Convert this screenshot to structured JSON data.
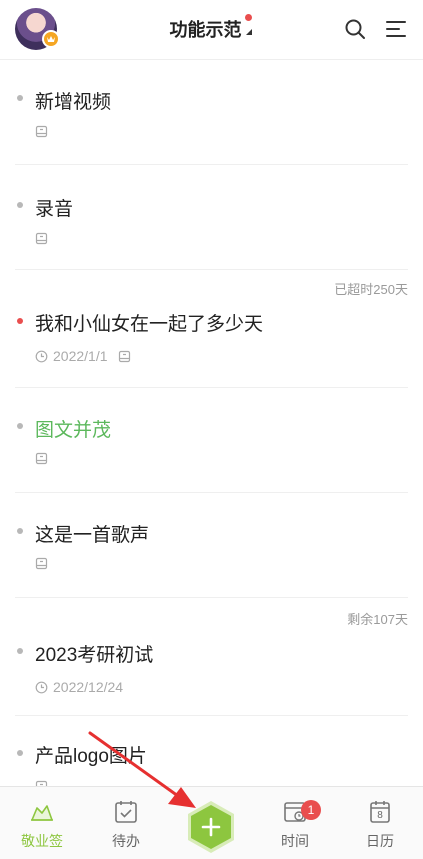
{
  "header": {
    "title": "功能示范"
  },
  "items": [
    {
      "name": "新增视频",
      "name_color": "default",
      "bullet": "gray",
      "date": "",
      "status": ""
    },
    {
      "name": "录音",
      "name_color": "default",
      "bullet": "gray",
      "date": "",
      "status": ""
    },
    {
      "name": "我和小仙女在一起了多少天",
      "name_color": "default",
      "bullet": "red",
      "date": "2022/1/1",
      "status": "已超时250天"
    },
    {
      "name": "图文并茂",
      "name_color": "green",
      "bullet": "gray",
      "date": "",
      "status": ""
    },
    {
      "name": "这是一首歌声",
      "name_color": "default",
      "bullet": "gray",
      "date": "",
      "status": ""
    },
    {
      "name": "2023考研初试",
      "name_color": "default",
      "bullet": "gray",
      "date": "2022/12/24",
      "status": "剩余107天"
    },
    {
      "name": "产品logo图片",
      "name_color": "default",
      "bullet": "gray",
      "date": "",
      "status": ""
    }
  ],
  "tabbar": {
    "tab1": "敬业签",
    "tab2": "待办",
    "tab4": "时间",
    "tab4_badge": "1",
    "tab5": "日历",
    "calendar_day": "8"
  },
  "colors": {
    "accent_green": "#8dc63f",
    "red": "#e94e4e",
    "badge_orange": "#f5a623"
  },
  "icons": [
    "search-icon",
    "menu-icon",
    "note-icon",
    "clock-icon",
    "todo-icon",
    "time-icon",
    "calendar-icon",
    "add-icon"
  ]
}
